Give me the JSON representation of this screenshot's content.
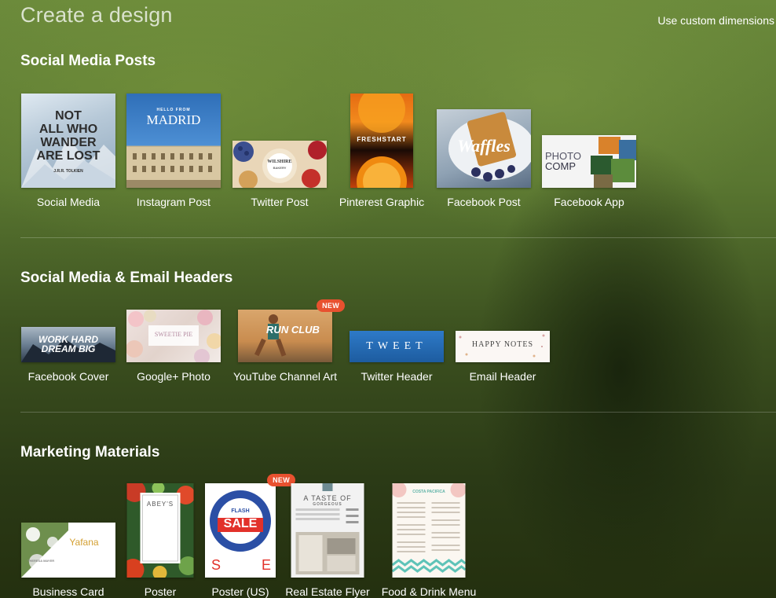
{
  "header": {
    "title": "Create a design",
    "custom_link": "Use custom dimensions"
  },
  "sections": [
    {
      "title": "Social Media Posts",
      "items": [
        {
          "label": "Social Media",
          "thumb": [
            "NOT",
            "ALL WHO",
            "WANDER",
            "ARE LOST",
            "J.R.R. TOLKIEN"
          ]
        },
        {
          "label": "Instagram Post",
          "thumb": [
            "HELLO FROM",
            "MADRID"
          ]
        },
        {
          "label": "Twitter Post",
          "thumb": [
            "WILSHIRE",
            "BAKERY"
          ]
        },
        {
          "label": "Pinterest Graphic",
          "thumb": [
            "FRESHSTART"
          ]
        },
        {
          "label": "Facebook Post",
          "thumb": [
            "Waffles"
          ]
        },
        {
          "label": "Facebook App",
          "thumb": [
            "PHOTO",
            "COMP"
          ]
        }
      ]
    },
    {
      "title": "Social Media & Email Headers",
      "items": [
        {
          "label": "Facebook Cover",
          "thumb": [
            "WORK HARD",
            "DREAM BIG"
          ]
        },
        {
          "label": "Google+ Photo",
          "thumb": [
            "SWEETIE PIE"
          ]
        },
        {
          "label": "YouTube Channel Art",
          "badge": "NEW",
          "thumb": [
            "RUN CLUB"
          ]
        },
        {
          "label": "Twitter Header",
          "thumb": [
            "TWEET"
          ]
        },
        {
          "label": "Email Header",
          "thumb": [
            "HAPPY NOTES"
          ]
        }
      ]
    },
    {
      "title": "Marketing Materials",
      "items": [
        {
          "label": "Business Card",
          "thumb": [
            "Yafana",
            "THERESA MAYER"
          ]
        },
        {
          "label": "Poster",
          "thumb": [
            "ABEY'S"
          ]
        },
        {
          "label": "Poster (US)",
          "badge": "NEW",
          "thumb": [
            "FLASH",
            "SALE"
          ]
        },
        {
          "label": "Real Estate Flyer",
          "thumb": [
            "A TASTE OF",
            "GORGEOUS"
          ]
        },
        {
          "label": "Food & Drink Menu",
          "thumb": [
            "COSTA PACIFICA"
          ]
        }
      ]
    }
  ],
  "colors": {
    "badge": "#e8512f",
    "background_top": "#6b8a3b",
    "background_bottom": "#24300f"
  }
}
